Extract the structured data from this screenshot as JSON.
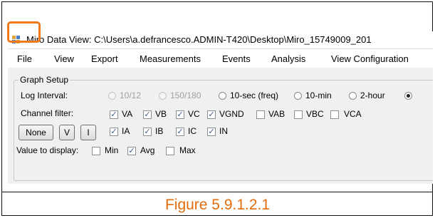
{
  "window": {
    "title": "Miro Data View: C:\\Users\\a.defrancesco.ADMIN-T420\\Desktop\\Miro_15749009_201"
  },
  "menu": [
    "File",
    "View",
    "Export",
    "Measurements",
    "Events",
    "Analysis",
    "View Configuration"
  ],
  "graph_setup": {
    "group_label": "Graph Setup",
    "log_interval_label": "Log Interval:",
    "log_interval_options": [
      {
        "label": "10/12",
        "enabled": false,
        "selected": false
      },
      {
        "label": "150/180",
        "enabled": false,
        "selected": false
      },
      {
        "label": "10-sec (freq)",
        "enabled": true,
        "selected": false
      },
      {
        "label": "10-min",
        "enabled": true,
        "selected": false
      },
      {
        "label": "2-hour",
        "enabled": true,
        "selected": false
      },
      {
        "label": "",
        "enabled": true,
        "selected": true
      }
    ],
    "channel_filter_label": "Channel filter:",
    "channels_row1": [
      {
        "label": "VA",
        "checked": true
      },
      {
        "label": "VB",
        "checked": true
      },
      {
        "label": "VC",
        "checked": true
      },
      {
        "label": "VGND",
        "checked": true
      },
      {
        "label": "VAB",
        "checked": false
      },
      {
        "label": "VBC",
        "checked": false
      },
      {
        "label": "VCA",
        "checked": false
      }
    ],
    "channels_row2": [
      {
        "label": "IA",
        "checked": true
      },
      {
        "label": "IB",
        "checked": true
      },
      {
        "label": "IC",
        "checked": true
      },
      {
        "label": "IN",
        "checked": true
      }
    ],
    "buttons": {
      "none": "None",
      "v": "V",
      "i": "I"
    },
    "value_display_label": "Value to display:",
    "value_options": [
      {
        "label": "Min",
        "checked": false
      },
      {
        "label": "Avg",
        "checked": true
      },
      {
        "label": "Max",
        "checked": false
      }
    ]
  },
  "caption": "Figure 5.9.1.2.1",
  "colors": {
    "highlight": "#f07a1a",
    "caption": "#e36c0a"
  }
}
